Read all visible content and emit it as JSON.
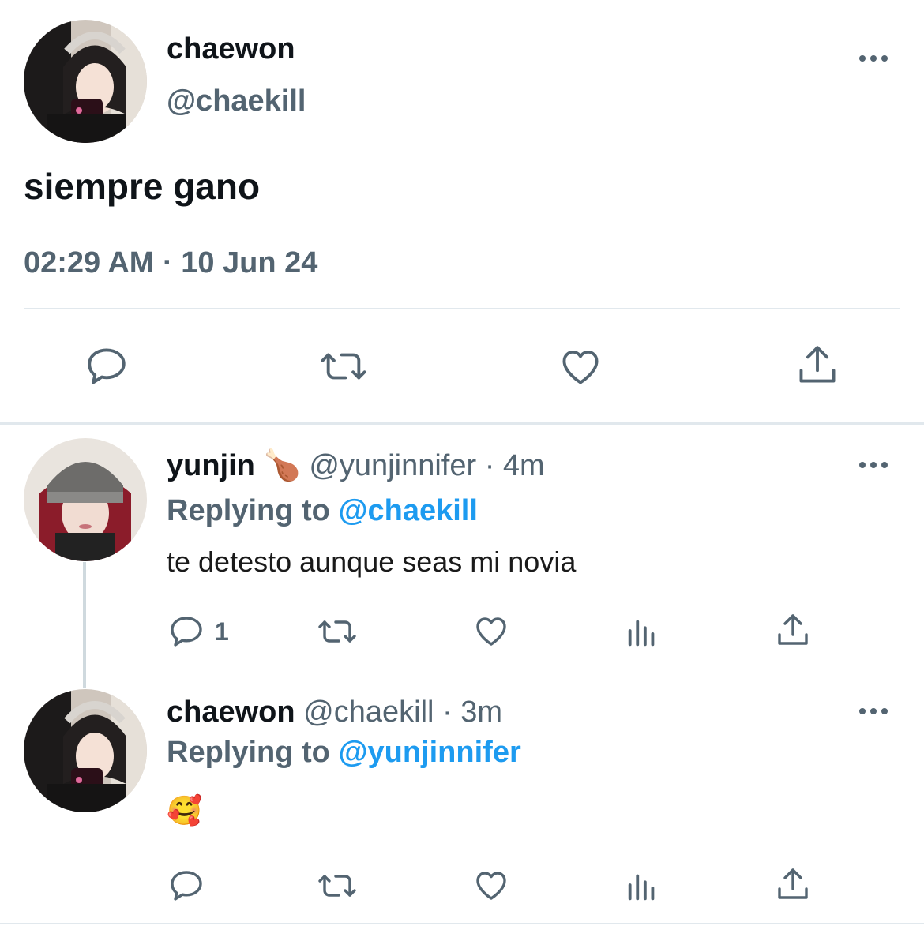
{
  "main_tweet": {
    "display_name": "chaewon",
    "handle": "@chaekill",
    "text": "siempre gano",
    "timestamp": "02:29 AM · 10 Jun 24",
    "avatar": "avatar-photo-chaewon",
    "more": "more-options-icon",
    "actions": [
      "reply-icon",
      "retweet-icon",
      "like-icon",
      "share-icon"
    ]
  },
  "replies": [
    {
      "display_name": "yunjin",
      "name_emoji": "🍗",
      "handle": "@yunjinnifer",
      "time": "· 4m",
      "replying_prefix": "Replying to",
      "replying_handle": "@chaekill",
      "text": "te detesto aunque seas mi novia",
      "reply_count": "1",
      "avatar": "avatar-photo-yunjin",
      "actions": [
        "reply-icon",
        "retweet-icon",
        "like-icon",
        "analytics-icon",
        "share-icon"
      ]
    },
    {
      "display_name": "chaewon",
      "handle": "@chaekill",
      "time": "· 3m",
      "replying_prefix": "Replying to",
      "replying_handle": "@yunjinnifer",
      "text": "🥰",
      "reply_count": "",
      "avatar": "avatar-photo-chaewon",
      "actions": [
        "reply-icon",
        "retweet-icon",
        "like-icon",
        "analytics-icon",
        "share-icon"
      ]
    }
  ],
  "colors": {
    "text": "#0f1419",
    "secondary": "#536471",
    "link": "#1d9bf0",
    "divider": "#e1e8ed"
  }
}
